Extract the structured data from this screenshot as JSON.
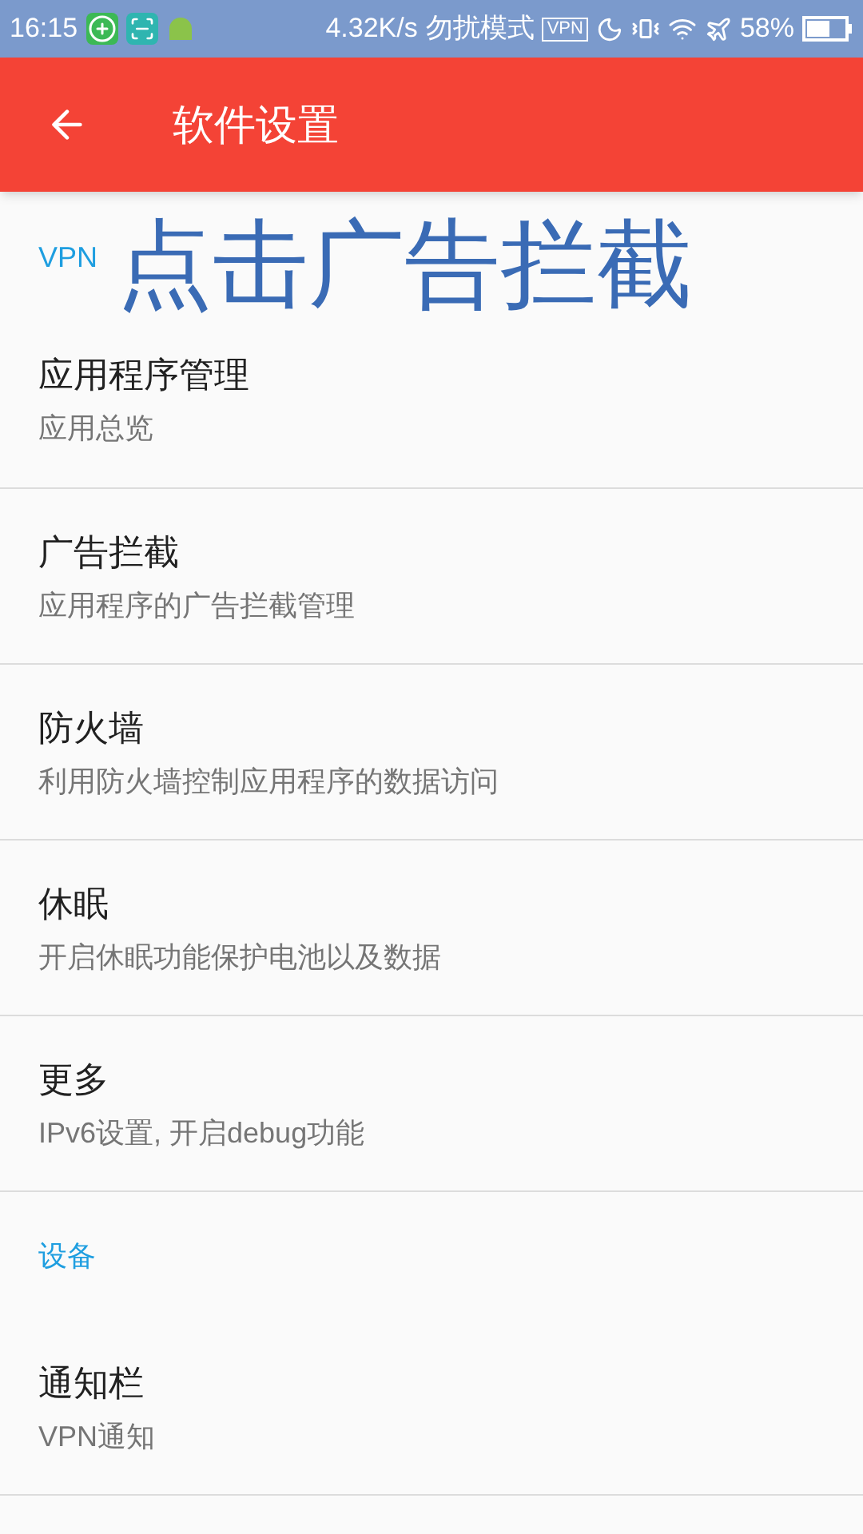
{
  "status_bar": {
    "time": "16:15",
    "speed": "4.32K/s",
    "mode": "勿扰模式",
    "vpn_badge": "VPN",
    "battery": "58%"
  },
  "app_bar": {
    "title": "软件设置"
  },
  "annotation": "点击广告拦截",
  "sections": [
    {
      "header": "VPN",
      "items": [
        {
          "title": "应用程序管理",
          "subtitle": "应用总览"
        },
        {
          "title": "广告拦截",
          "subtitle": "应用程序的广告拦截管理"
        },
        {
          "title": "防火墙",
          "subtitle": "利用防火墙控制应用程序的数据访问"
        },
        {
          "title": "休眠",
          "subtitle": "开启休眠功能保护电池以及数据"
        },
        {
          "title": "更多",
          "subtitle": "IPv6设置, 开启debug功能"
        }
      ]
    },
    {
      "header": "设备",
      "items": [
        {
          "title": "通知栏",
          "subtitle": "VPN通知"
        }
      ]
    }
  ]
}
